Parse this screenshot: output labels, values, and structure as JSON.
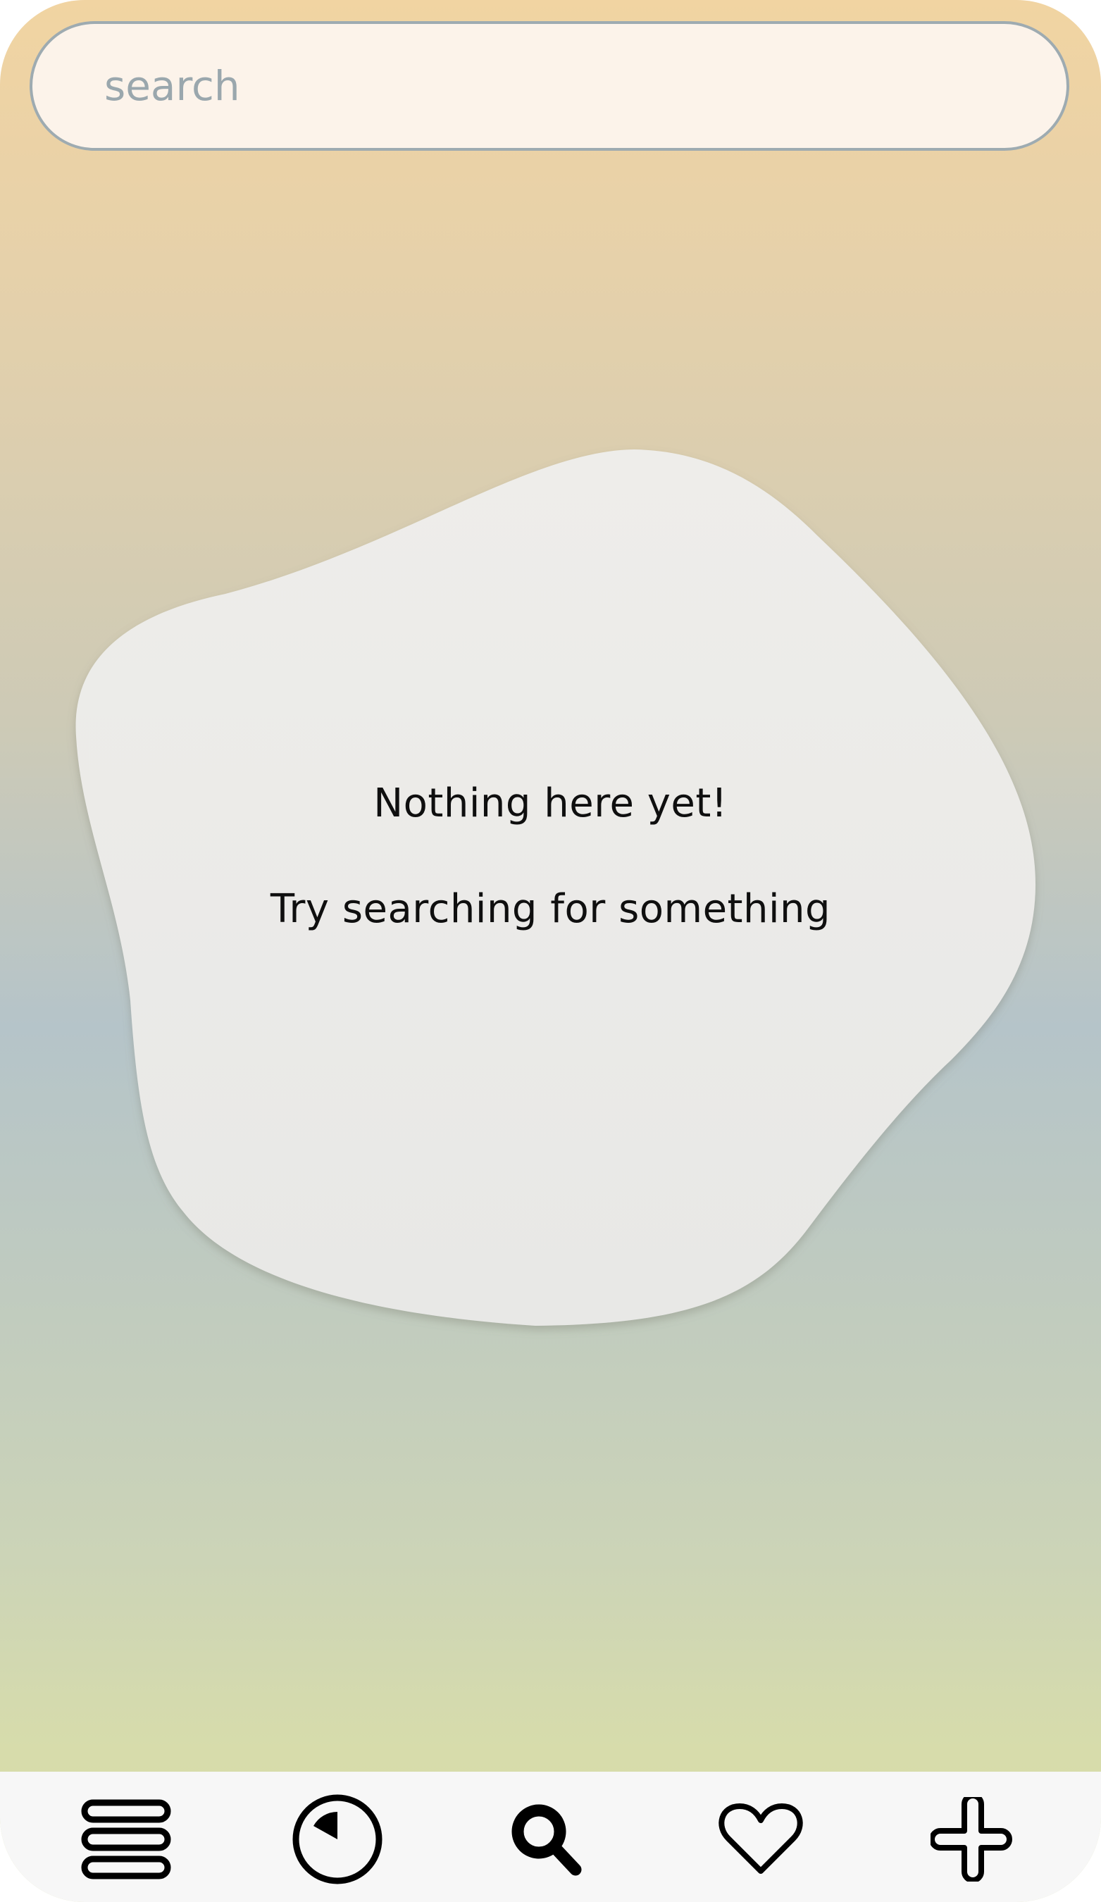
{
  "search": {
    "placeholder": "search",
    "value": ""
  },
  "empty_state": {
    "title": "Nothing here yet!",
    "subtitle": "Try searching for something"
  },
  "bottom_nav": {
    "items": [
      {
        "name": "menu",
        "icon": "menu-icon"
      },
      {
        "name": "history",
        "icon": "clock-icon"
      },
      {
        "name": "search",
        "icon": "search-icon",
        "active": true
      },
      {
        "name": "favorites",
        "icon": "heart-icon"
      },
      {
        "name": "add",
        "icon": "plus-icon"
      }
    ]
  },
  "colors": {
    "gradient_top": "#f1d4a2",
    "gradient_middle": "#b5c4c9",
    "gradient_bottom": "#d9dca8",
    "search_background": "#fcf3ea",
    "search_border": "#9eabb1",
    "blob_fill": "#ebeae8",
    "nav_background": "#f7f7f7",
    "text": "#0f0f0f"
  }
}
